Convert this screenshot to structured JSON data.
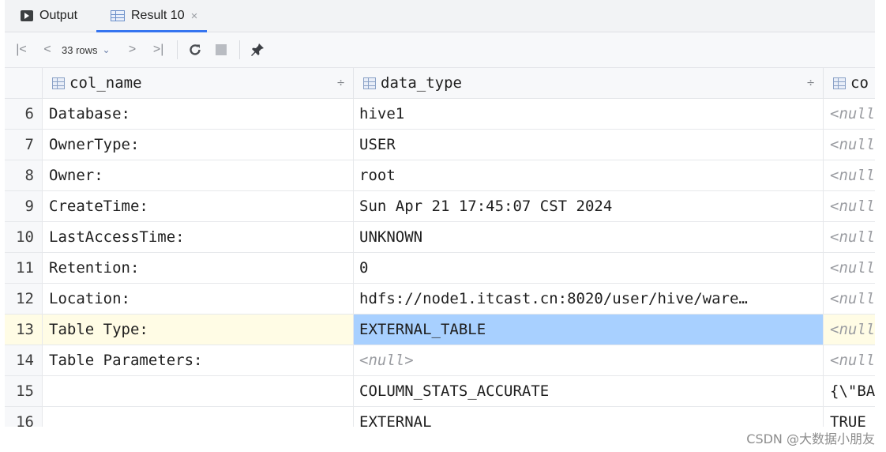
{
  "tabs": [
    {
      "label": "Output",
      "icon": "output-console-icon"
    },
    {
      "label": "Result 10",
      "icon": "table-grid-icon",
      "close": "×"
    }
  ],
  "toolbar": {
    "first": "|<",
    "prev": "<",
    "rows_label": "33 rows",
    "next": ">",
    "last": ">|",
    "refresh_icon": "refresh-icon",
    "stop_icon": "stop-icon",
    "pin_icon": "pin-icon"
  },
  "columns": [
    {
      "name": "col_name",
      "sort": "÷"
    },
    {
      "name": "data_type",
      "sort": "÷"
    },
    {
      "name": "co"
    }
  ],
  "rows": [
    {
      "n": "6",
      "col_name": "Database:",
      "data_type": "hive1",
      "comment": "<null"
    },
    {
      "n": "7",
      "col_name": "OwnerType:",
      "data_type": "USER",
      "comment": "<null"
    },
    {
      "n": "8",
      "col_name": "Owner:",
      "data_type": "root",
      "comment": "<null"
    },
    {
      "n": "9",
      "col_name": "CreateTime:",
      "data_type": "Sun Apr 21 17:45:07 CST 2024",
      "comment": "<null"
    },
    {
      "n": "10",
      "col_name": "LastAccessTime:",
      "data_type": "UNKNOWN",
      "comment": "<null"
    },
    {
      "n": "11",
      "col_name": "Retention:",
      "data_type": "0",
      "comment": "<null"
    },
    {
      "n": "12",
      "col_name": "Location:",
      "data_type": "hdfs://node1.itcast.cn:8020/user/hive/ware…",
      "comment": "<null"
    },
    {
      "n": "13",
      "col_name": "Table Type:",
      "data_type": "EXTERNAL_TABLE",
      "comment": "<null"
    },
    {
      "n": "14",
      "col_name": "Table Parameters:",
      "data_type": "<null>",
      "comment": "<null"
    },
    {
      "n": "15",
      "col_name": "",
      "data_type": "COLUMN_STATS_ACCURATE",
      "comment": "{\\\"BA"
    },
    {
      "n": "16",
      "col_name": "",
      "data_type": "EXTERNAL",
      "comment": "TRUE"
    }
  ],
  "selected_row": "13",
  "watermark": "CSDN @大数据小朋友",
  "colors": {
    "accent": "#3574f0",
    "selection": "#a8d0ff",
    "row_highlight": "#fffce5"
  }
}
